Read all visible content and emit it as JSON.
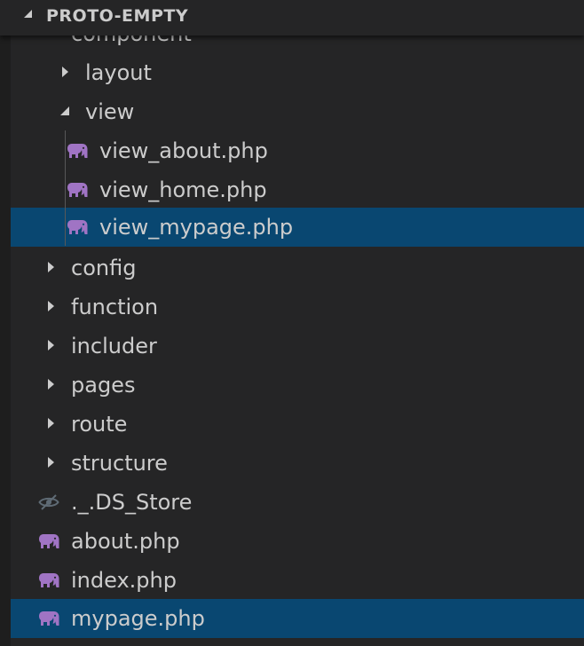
{
  "explorer": {
    "project_name": "PROTO-EMPTY",
    "items": [
      {
        "label": "component",
        "type": "folder",
        "expanded": false
      },
      {
        "label": "layout",
        "type": "folder",
        "expanded": false
      },
      {
        "label": "view",
        "type": "folder",
        "expanded": true
      },
      {
        "label": "view_about.php",
        "type": "php-file"
      },
      {
        "label": "view_home.php",
        "type": "php-file"
      },
      {
        "label": "view_mypage.php",
        "type": "php-file",
        "selected": true
      },
      {
        "label": "config",
        "type": "folder",
        "expanded": false
      },
      {
        "label": "function",
        "type": "folder",
        "expanded": false
      },
      {
        "label": "includer",
        "type": "folder",
        "expanded": false
      },
      {
        "label": "pages",
        "type": "folder",
        "expanded": false
      },
      {
        "label": "route",
        "type": "folder",
        "expanded": false
      },
      {
        "label": "structure",
        "type": "folder",
        "expanded": false
      },
      {
        "label": "._.DS_Store",
        "type": "hidden-file"
      },
      {
        "label": "about.php",
        "type": "php-file"
      },
      {
        "label": "index.php",
        "type": "php-file"
      },
      {
        "label": "mypage.php",
        "type": "php-file",
        "selected": true
      }
    ]
  },
  "colors": {
    "background": "#252526",
    "selection": "#094771",
    "text": "#cccccc",
    "php_icon": "#a074c4",
    "hidden_icon": "#5f6b75"
  },
  "icons": {
    "php": "elephant-icon",
    "hidden": "eye-slash-icon",
    "collapsed": "chevron-right-icon",
    "expanded": "chevron-down-icon"
  }
}
